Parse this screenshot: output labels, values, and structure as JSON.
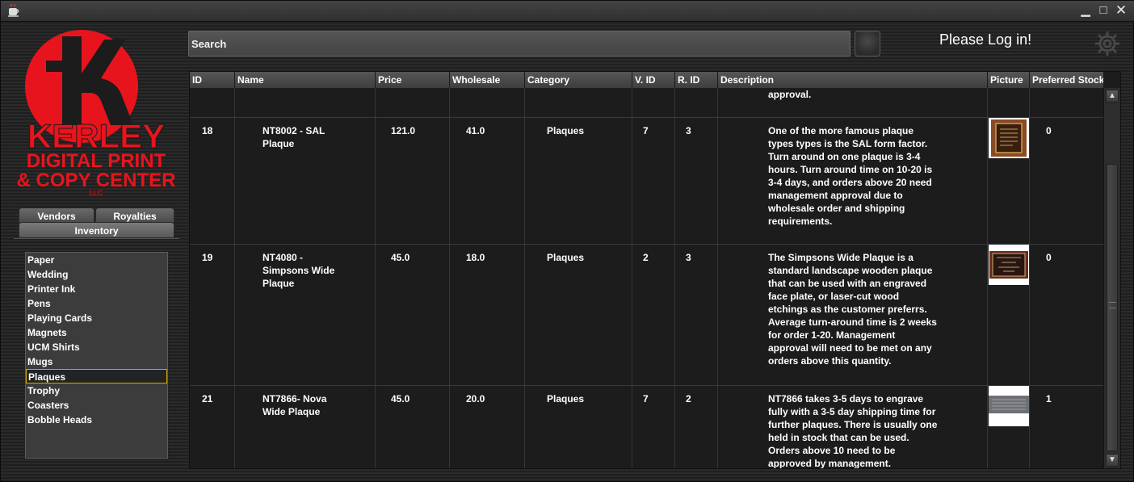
{
  "window": {
    "minimize_glyph": "▁",
    "maximize_glyph": "□",
    "close_glyph": "✕"
  },
  "logo": {
    "line1": "KERLEY",
    "line2": "DIGITAL PRINT",
    "line3": "& COPY CENTER",
    "line4": "LLC",
    "color": "#e8141d"
  },
  "search": {
    "placeholder": "Search"
  },
  "header": {
    "login_text": "Please Log in!"
  },
  "tabs": {
    "vendors": "Vendors",
    "royalties": "Royalties",
    "inventory": "Inventory"
  },
  "categories": {
    "items": [
      "Paper",
      "Wedding",
      "Printer Ink",
      "Pens",
      "Playing Cards",
      "Magnets",
      "UCM Shirts",
      "Mugs",
      "Plaques",
      "Trophy",
      "Coasters",
      "Bobble Heads"
    ],
    "selected": "Plaques"
  },
  "table": {
    "columns": [
      "ID",
      "Name",
      "Price",
      "Wholesale",
      "Category",
      "V. ID",
      "R. ID",
      "Description",
      "Picture",
      "Preferred Stock"
    ],
    "partial_row_desc": "approval.",
    "rows": [
      {
        "id": "18",
        "name": "NT8002 - SAL\nPlaque",
        "price": "121.0",
        "wholesale": "41.0",
        "category": "Plaques",
        "vid": "7",
        "rid": "3",
        "description": "One of the more famous plaque\ntypes types is the SAL form factor.\nTurn around on one plaque is 3-4\nhours. Turn around time on 10-20 is\n3-4 days, and orders above 20 need\nmanagement approval due to\nwholesale order and shipping\nrequirements.",
        "preferred_stock": "0"
      },
      {
        "id": "19",
        "name": "NT4080 -\nSimpsons Wide\nPlaque",
        "price": "45.0",
        "wholesale": "18.0",
        "category": "Plaques",
        "vid": "2",
        "rid": "3",
        "description": "The Simpsons Wide Plaque is a\nstandard landscape wooden plaque\nthat can be used with an engraved\nface plate, or laser-cut wood\netchings as the customer preferrs.\nAverage turn-around time is 2 weeks\nfor order 1-20. Management\napproval will need to be met on any\norders above this quantity.",
        "preferred_stock": "0"
      },
      {
        "id": "21",
        "name": "NT7866- Nova\nWide Plaque",
        "price": "45.0",
        "wholesale": "20.0",
        "category": "Plaques",
        "vid": "7",
        "rid": "2",
        "description": "NT7866 takes 3-5 days to engrave\nfully with a 3-5 day shipping time for\nfurther plaques. There is usually one\nheld in stock that can be used.\nOrders above 10 need to be\napproved by management.",
        "preferred_stock": "1"
      }
    ]
  }
}
